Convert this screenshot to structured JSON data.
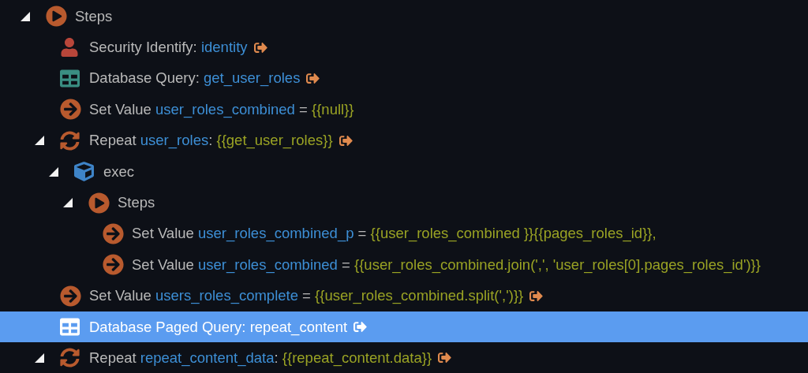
{
  "tree": [
    {
      "kind": "steps",
      "expanded": true,
      "selected": false,
      "link": false,
      "parts": [
        {
          "kind": "text",
          "text": "Steps"
        }
      ],
      "children": [
        {
          "kind": "user",
          "selected": false,
          "link": true,
          "parts": [
            {
              "kind": "text",
              "text": "Security Identify: "
            },
            {
              "kind": "name",
              "text": "identity"
            }
          ]
        },
        {
          "kind": "database",
          "selected": false,
          "link": true,
          "parts": [
            {
              "kind": "text",
              "text": "Database Query: "
            },
            {
              "kind": "name",
              "text": "get_user_roles"
            }
          ]
        },
        {
          "kind": "set",
          "selected": false,
          "link": false,
          "parts": [
            {
              "kind": "text",
              "text": "Set Value "
            },
            {
              "kind": "name",
              "text": "user_roles_combined"
            },
            {
              "kind": "text",
              "text": " = "
            },
            {
              "kind": "expr",
              "text": "{{null}}"
            }
          ]
        },
        {
          "kind": "repeat",
          "expanded": true,
          "selected": false,
          "link": true,
          "parts": [
            {
              "kind": "text",
              "text": "Repeat "
            },
            {
              "kind": "name",
              "text": "user_roles"
            },
            {
              "kind": "text",
              "text": ": "
            },
            {
              "kind": "expr",
              "text": "{{get_user_roles}}"
            }
          ],
          "children": [
            {
              "kind": "exec",
              "expanded": true,
              "selected": false,
              "link": false,
              "parts": [
                {
                  "kind": "text",
                  "text": "exec"
                }
              ],
              "children": [
                {
                  "kind": "steps",
                  "expanded": true,
                  "selected": false,
                  "link": false,
                  "parts": [
                    {
                      "kind": "text",
                      "text": "Steps"
                    }
                  ],
                  "children": [
                    {
                      "kind": "set",
                      "selected": false,
                      "link": false,
                      "parts": [
                        {
                          "kind": "text",
                          "text": "Set Value "
                        },
                        {
                          "kind": "name",
                          "text": "user_roles_combined_p"
                        },
                        {
                          "kind": "text",
                          "text": " = "
                        },
                        {
                          "kind": "expr",
                          "text": "{{user_roles_combined }}{{pages_roles_id}},"
                        }
                      ]
                    },
                    {
                      "kind": "set",
                      "selected": false,
                      "link": false,
                      "parts": [
                        {
                          "kind": "text",
                          "text": "Set Value "
                        },
                        {
                          "kind": "name",
                          "text": "user_roles_combined"
                        },
                        {
                          "kind": "text",
                          "text": " = "
                        },
                        {
                          "kind": "expr",
                          "text": "{{user_roles_combined.join(',', 'user_roles[0].pages_roles_id')}}"
                        }
                      ]
                    }
                  ]
                }
              ]
            }
          ]
        },
        {
          "kind": "set",
          "selected": false,
          "link": true,
          "parts": [
            {
              "kind": "text",
              "text": "Set Value "
            },
            {
              "kind": "name",
              "text": "users_roles_complete"
            },
            {
              "kind": "text",
              "text": " = "
            },
            {
              "kind": "expr",
              "text": "{{user_roles_combined.split(',')}}"
            }
          ]
        },
        {
          "kind": "database",
          "selected": true,
          "link": true,
          "parts": [
            {
              "kind": "text",
              "text": "Database Paged Query: "
            },
            {
              "kind": "name",
              "text": "repeat_content"
            }
          ]
        },
        {
          "kind": "repeat",
          "expanded": true,
          "selected": false,
          "link": true,
          "parts": [
            {
              "kind": "text",
              "text": "Repeat "
            },
            {
              "kind": "name",
              "text": "repeat_content_data"
            },
            {
              "kind": "text",
              "text": ": "
            },
            {
              "kind": "expr",
              "text": "{{repeat_content.data}}"
            }
          ]
        }
      ]
    }
  ]
}
